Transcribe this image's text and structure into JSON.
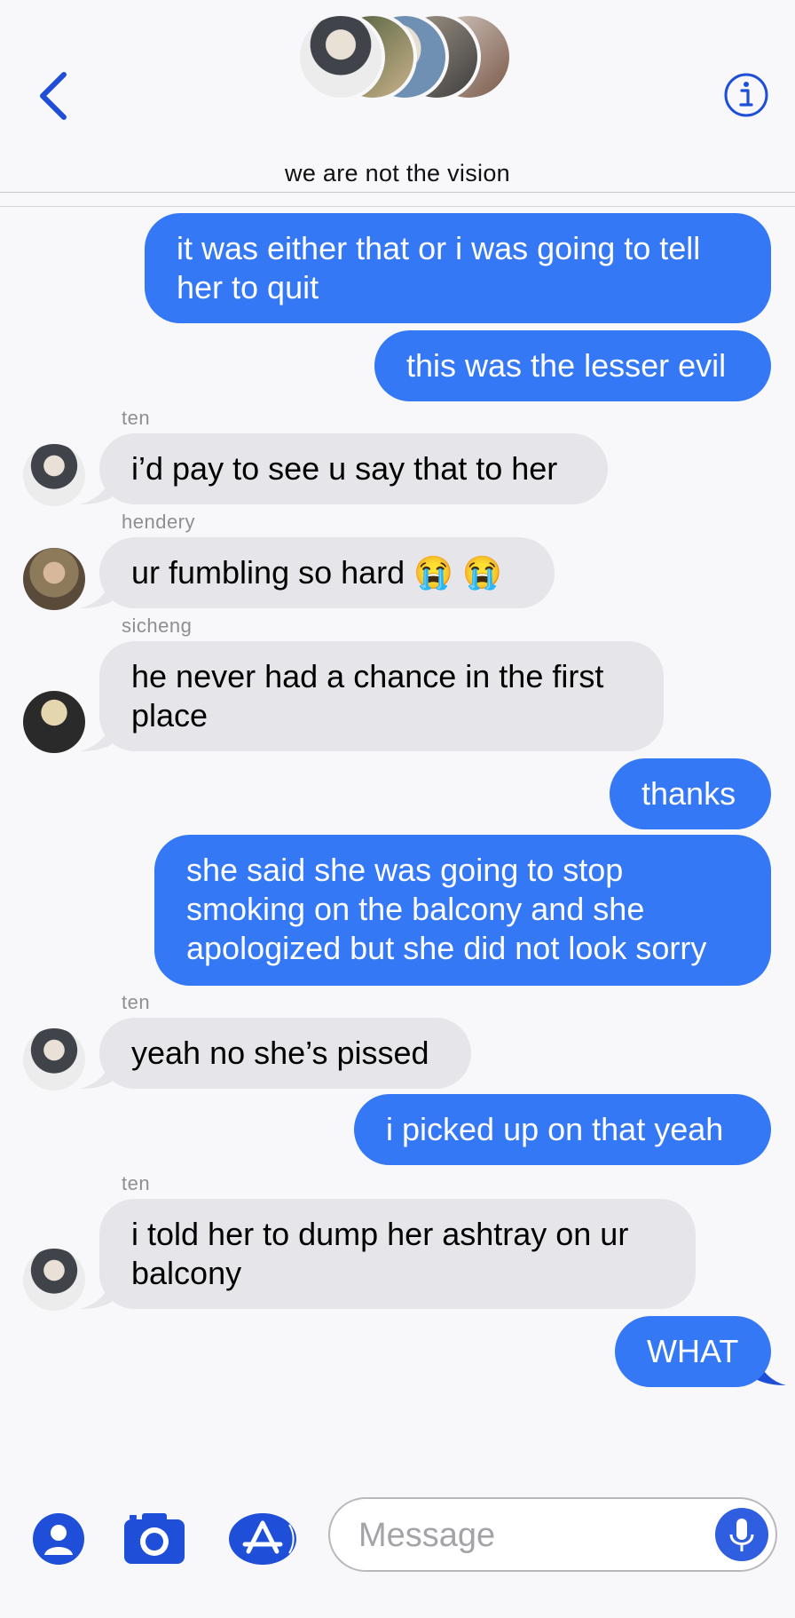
{
  "header": {
    "chat_title": "we are not the vision",
    "back_icon": "chevron-left-icon",
    "info_icon": "info-icon"
  },
  "messages": [
    {
      "direction": "outgoing",
      "text": "it was either that or i was going to tell her to quit"
    },
    {
      "direction": "outgoing",
      "text": "this was the lesser evil"
    },
    {
      "direction": "incoming",
      "sender": "ten",
      "text": "i’d pay to see u say that to her"
    },
    {
      "direction": "incoming",
      "sender": "hendery",
      "text": "ur fumbling so hard 😭 😭"
    },
    {
      "direction": "incoming",
      "sender": "sicheng",
      "text": "he never had a chance in the first place"
    },
    {
      "direction": "outgoing",
      "text": "thanks"
    },
    {
      "direction": "outgoing",
      "text": "she said she was going to stop smoking on the balcony and she apologized but she did not look sorry"
    },
    {
      "direction": "incoming",
      "sender": "ten",
      "text": "yeah no she’s pissed"
    },
    {
      "direction": "outgoing",
      "text": "i picked up on that yeah"
    },
    {
      "direction": "incoming",
      "sender": "ten",
      "text": "i told her to dump her ashtray on ur balcony"
    },
    {
      "direction": "outgoing",
      "text": "WHAT"
    }
  ],
  "composer": {
    "placeholder": "Message",
    "icons": [
      "contact-icon",
      "camera-icon",
      "app-store-icon",
      "microphone-icon"
    ]
  },
  "colors": {
    "outgoing_bubble": "#3478f6",
    "incoming_bubble": "#e5e5ea",
    "accent": "#1f4fd8",
    "sender_label": "#8e8e93"
  }
}
